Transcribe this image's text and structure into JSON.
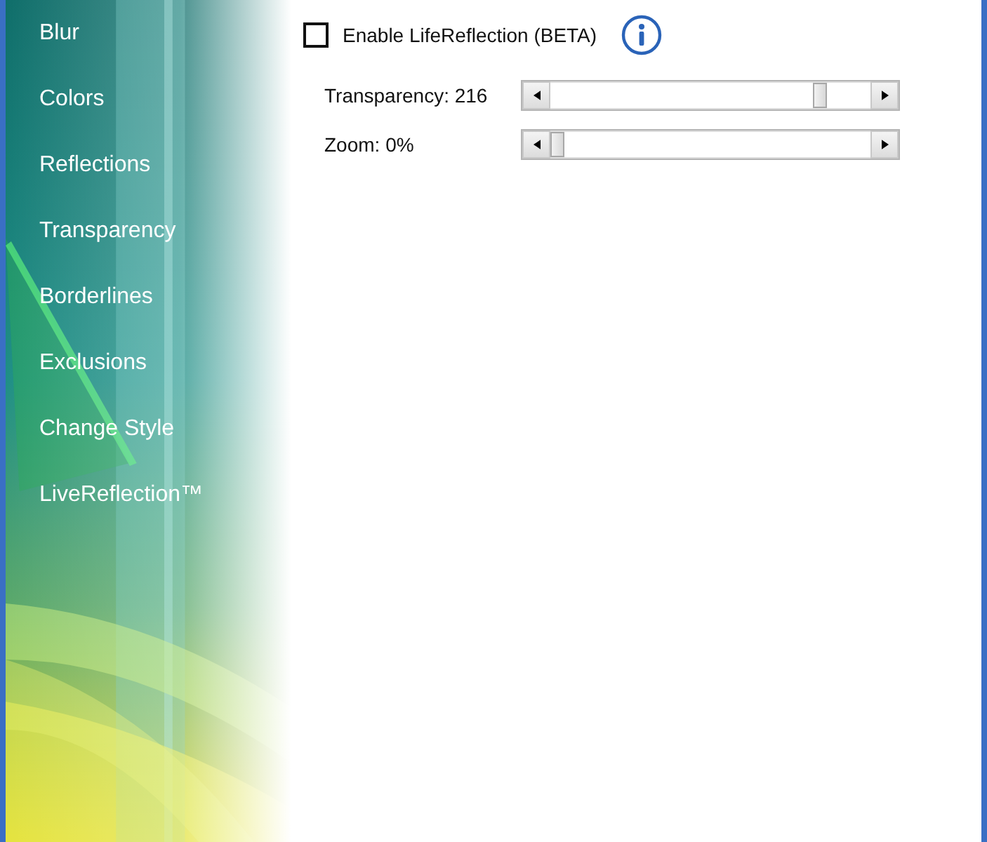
{
  "sidebar": {
    "items": [
      {
        "label": "Blur"
      },
      {
        "label": "Colors"
      },
      {
        "label": "Reflections"
      },
      {
        "label": "Transparency"
      },
      {
        "label": "Borderlines"
      },
      {
        "label": "Exclusions"
      },
      {
        "label": "Change Style"
      },
      {
        "label": "LiveReflection™"
      }
    ]
  },
  "enable": {
    "label": "Enable LifeReflection (BETA)",
    "checked": false
  },
  "sliders": [
    {
      "label": "Transparency: 216",
      "level": 0.86
    },
    {
      "label": "Zoom: 0%",
      "level": 0
    }
  ]
}
